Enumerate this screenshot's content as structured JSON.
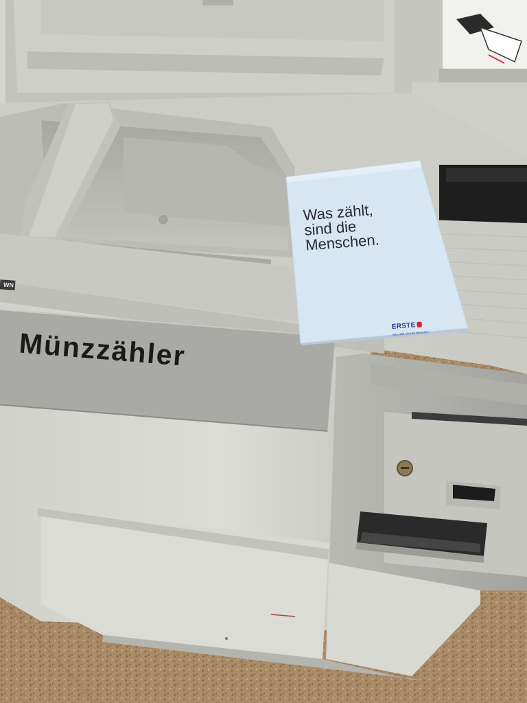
{
  "machine": {
    "label": "Münzzähler",
    "brand_tag": "WN"
  },
  "envelope": {
    "slogan_lines": [
      "Was zählt,",
      "sind die",
      "Menschen."
    ],
    "logo_text": "ERSTE",
    "logo_tagline": "Was zählt, sind die Menschen."
  },
  "colors": {
    "machine_body": "#d8d8d3",
    "plate": "#a9a9a6",
    "envelope": "#d6e6f3",
    "floor": "#a88a66",
    "brand_blue": "#2b3990",
    "brand_red": "#d8232a"
  }
}
